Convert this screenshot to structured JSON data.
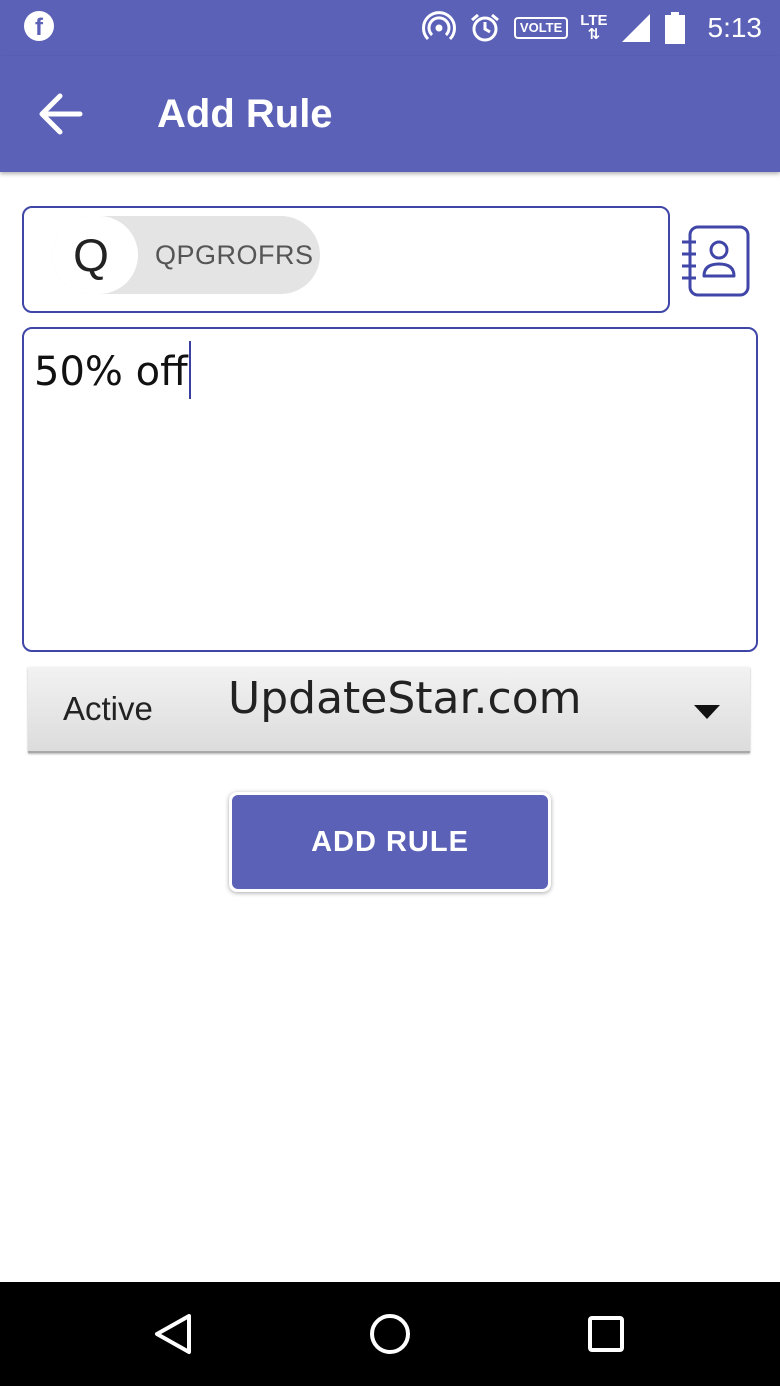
{
  "status_bar": {
    "time": "5:13",
    "volte_label": "VOLTE",
    "lte_label": "LTE",
    "icons": [
      "facebook-icon",
      "hotspot-icon",
      "alarm-icon",
      "volte-icon",
      "lte-icon",
      "signal-icon",
      "battery-icon"
    ]
  },
  "app_bar": {
    "title": "Add Rule",
    "back_icon": "arrow-left-icon"
  },
  "recipient": {
    "chip_initial": "Q",
    "chip_label": "QPGROFRS",
    "contacts_icon": "contact-book-icon"
  },
  "message": {
    "value": "50% off"
  },
  "status_select": {
    "selected": "Active",
    "arrow_icon": "dropdown-arrow-icon"
  },
  "watermark": "UpdateStar.com",
  "add_button": {
    "label": "ADD RULE"
  },
  "nav_bar": {
    "icons": [
      "back-triangle-icon",
      "home-circle-icon",
      "recents-square-icon"
    ]
  },
  "colors": {
    "primary": "#5c61b8",
    "border": "#4046a8",
    "chip_bg": "#e4e4e4"
  }
}
